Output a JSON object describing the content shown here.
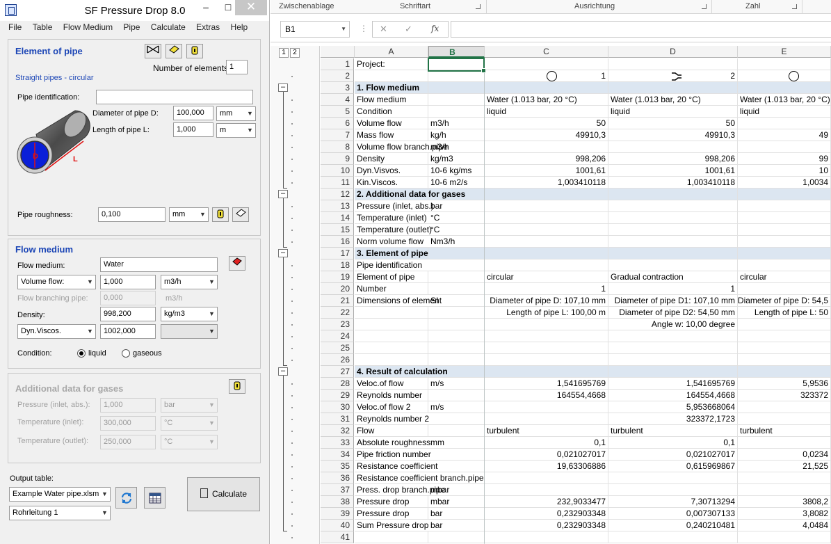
{
  "app": {
    "title": "SF Pressure Drop 8.0",
    "window_controls": {
      "minimize": "–",
      "maximize": "□",
      "close": "✕"
    },
    "menu": [
      "File",
      "Table",
      "Flow Medium",
      "Pipe",
      "Calculate",
      "Extras",
      "Help"
    ],
    "element_of_pipe": {
      "title": "Element of pipe",
      "subtitle": "Straight pipes - circular",
      "number_label": "Number of elements:",
      "number_value": "1",
      "pipe_identification_label": "Pipe identification:",
      "pipe_identification_value": "",
      "diameter_label": "Diameter of pipe D:",
      "diameter_value": "100,000",
      "diameter_unit": "mm",
      "length_label": "Length of pipe L:",
      "length_value": "1,000",
      "length_unit": "m",
      "roughness_label": "Pipe roughness:",
      "roughness_value": "0,100",
      "roughness_unit": "mm",
      "diagram_d": "D",
      "diagram_l": "L"
    },
    "flow_medium": {
      "title": "Flow medium",
      "medium_label": "Flow medium:",
      "medium_value": "Water",
      "volume_flow_select": "Volume flow:",
      "volume_flow_value": "1,000",
      "volume_flow_unit": "m3/h",
      "branching_label": "Flow branching pipe:",
      "branching_value": "0,000",
      "branching_unit": "m3/h",
      "density_label": "Density:",
      "density_value": "998,200",
      "density_unit": "kg/m3",
      "visc_select": "Dyn.Viscos.",
      "visc_value": "1002,000",
      "visc_unit": "",
      "condition_label": "Condition:",
      "liquid": "liquid",
      "gaseous": "gaseous"
    },
    "gases": {
      "title": "Additional data for gases",
      "pressure_label": "Pressure (inlet, abs.):",
      "pressure_value": "1,000",
      "pressure_unit": "bar",
      "temp_in_label": "Temperature (inlet):",
      "temp_in_value": "300,000",
      "temp_in_unit": "°C",
      "temp_out_label": "Temperature (outlet):",
      "temp_out_value": "250,000",
      "temp_out_unit": "°C"
    },
    "output": {
      "label": "Output table:",
      "file": "Example Water pipe.xlsm",
      "sheet": "Rohrleitung 1",
      "calculate": "Calculate"
    }
  },
  "excel": {
    "ribbon_groups": [
      "Zwischenablage",
      "Schriftart",
      "Ausrichtung",
      "Zahl"
    ],
    "name_box": "B1",
    "outline_levels": [
      "1",
      "2"
    ],
    "columns": [
      "A",
      "B",
      "C",
      "D",
      "E"
    ],
    "rows": [
      {
        "n": "1",
        "a": "Project:",
        "b": "",
        "c": "",
        "d": "",
        "e": ""
      },
      {
        "n": "2",
        "a": "",
        "b": "",
        "c": "1",
        "d": "2",
        "e": "",
        "icons": true
      },
      {
        "n": "3",
        "a": "1. Flow medium",
        "b": "",
        "c": "",
        "d": "",
        "e": "",
        "section": true
      },
      {
        "n": "4",
        "a": "Flow medium",
        "b": "",
        "c": "Water (1.013 bar, 20 °C)",
        "d": "Water (1.013 bar, 20 °C)",
        "e": "Water (1.013 bar, 20 °C)"
      },
      {
        "n": "5",
        "a": "Condition",
        "b": "",
        "c": "liquid",
        "d": "liquid",
        "e": "liquid"
      },
      {
        "n": "6",
        "a": "Volume flow",
        "b": "m3/h",
        "c": "50",
        "d": "50",
        "e": ""
      },
      {
        "n": "7",
        "a": "Mass flow",
        "b": "kg/h",
        "c": "49910,3",
        "d": "49910,3",
        "e": "49"
      },
      {
        "n": "8",
        "a": "Volume flow branch.pipe",
        "b": "m3/h",
        "c": "",
        "d": "",
        "e": ""
      },
      {
        "n": "9",
        "a": "Density",
        "b": "kg/m3",
        "c": "998,206",
        "d": "998,206",
        "e": "99"
      },
      {
        "n": "10",
        "a": "Dyn.Visvos.",
        "b": "10-6 kg/ms",
        "c": "1001,61",
        "d": "1001,61",
        "e": "10"
      },
      {
        "n": "11",
        "a": "Kin.Viscos.",
        "b": "10-6 m2/s",
        "c": "1,003410118",
        "d": "1,003410118",
        "e": "1,0034"
      },
      {
        "n": "12",
        "a": "2. Additional data for gases",
        "b": "",
        "c": "",
        "d": "",
        "e": "",
        "section": true
      },
      {
        "n": "13",
        "a": "Pressure (inlet, abs.)",
        "b": "bar",
        "c": "",
        "d": "",
        "e": ""
      },
      {
        "n": "14",
        "a": "Temperature (inlet)",
        "b": "°C",
        "c": "",
        "d": "",
        "e": ""
      },
      {
        "n": "15",
        "a": "Temperature (outlet)",
        "b": "°C",
        "c": "",
        "d": "",
        "e": ""
      },
      {
        "n": "16",
        "a": "Norm volume flow",
        "b": "Nm3/h",
        "c": "",
        "d": "",
        "e": ""
      },
      {
        "n": "17",
        "a": "3. Element of pipe",
        "b": "",
        "c": "",
        "d": "",
        "e": "",
        "section": true
      },
      {
        "n": "18",
        "a": "Pipe identification",
        "b": "",
        "c": "",
        "d": "",
        "e": ""
      },
      {
        "n": "19",
        "a": "Element of pipe",
        "b": "",
        "c": "circular",
        "d": "Gradual contraction",
        "e": "circular"
      },
      {
        "n": "20",
        "a": "Number",
        "b": "",
        "c": "1",
        "d": "1",
        "e": ""
      },
      {
        "n": "21",
        "a": "Dimensions of element",
        "b": "SI",
        "c": "Diameter of pipe D: 107,10 mm",
        "d": "Diameter of pipe D1: 107,10 mm",
        "e": "Diameter of pipe D: 54,5"
      },
      {
        "n": "22",
        "a": "",
        "b": "",
        "c": "Length of pipe L: 100,00 m",
        "d": "Diameter of pipe D2: 54,50 mm",
        "e": "Length of pipe L: 50"
      },
      {
        "n": "23",
        "a": "",
        "b": "",
        "c": "",
        "d": "Angle w: 10,00 degree",
        "e": ""
      },
      {
        "n": "24",
        "a": "",
        "b": "",
        "c": "",
        "d": "",
        "e": ""
      },
      {
        "n": "25",
        "a": "",
        "b": "",
        "c": "",
        "d": "",
        "e": ""
      },
      {
        "n": "26",
        "a": "",
        "b": "",
        "c": "",
        "d": "",
        "e": ""
      },
      {
        "n": "27",
        "a": "4. Result of calculation",
        "b": "",
        "c": "",
        "d": "",
        "e": "",
        "section": true
      },
      {
        "n": "28",
        "a": "Veloc.of flow",
        "b": "m/s",
        "c": "1,541695769",
        "d": "1,541695769",
        "e": "5,9536"
      },
      {
        "n": "29",
        "a": "Reynolds number",
        "b": "",
        "c": "164554,4668",
        "d": "164554,4668",
        "e": "323372"
      },
      {
        "n": "30",
        "a": "Veloc.of flow 2",
        "b": "m/s",
        "c": "",
        "d": "5,953668064",
        "e": ""
      },
      {
        "n": "31",
        "a": "Reynolds number 2",
        "b": "",
        "c": "",
        "d": "323372,1723",
        "e": ""
      },
      {
        "n": "32",
        "a": "Flow",
        "b": "",
        "c": "turbulent",
        "d": "turbulent",
        "e": "turbulent"
      },
      {
        "n": "33",
        "a": "Absolute roughness",
        "b": "mm",
        "c": "0,1",
        "d": "0,1",
        "e": ""
      },
      {
        "n": "34",
        "a": "Pipe friction number",
        "b": "",
        "c": "0,021027017",
        "d": "0,021027017",
        "e": "0,0234"
      },
      {
        "n": "35",
        "a": "Resistance coefficient",
        "b": "",
        "c": "19,63306886",
        "d": "0,615969867",
        "e": "21,525"
      },
      {
        "n": "36",
        "a": "Resistance coefficient branch.pipe",
        "b": "",
        "c": "",
        "d": "",
        "e": ""
      },
      {
        "n": "37",
        "a": "Press. drop branch.pipe",
        "b": "mbar",
        "c": "",
        "d": "",
        "e": ""
      },
      {
        "n": "38",
        "a": "Pressure drop",
        "b": "mbar",
        "c": "232,9033477",
        "d": "7,30713294",
        "e": "3808,2"
      },
      {
        "n": "39",
        "a": "Pressure drop",
        "b": "bar",
        "c": "0,232903348",
        "d": "0,007307133",
        "e": "3,8082"
      },
      {
        "n": "40",
        "a": "Sum Pressure drop",
        "b": "bar",
        "c": "0,232903348",
        "d": "0,240210481",
        "e": "4,0484"
      },
      {
        "n": "41",
        "a": "",
        "b": "",
        "c": "",
        "d": "",
        "e": ""
      }
    ]
  }
}
